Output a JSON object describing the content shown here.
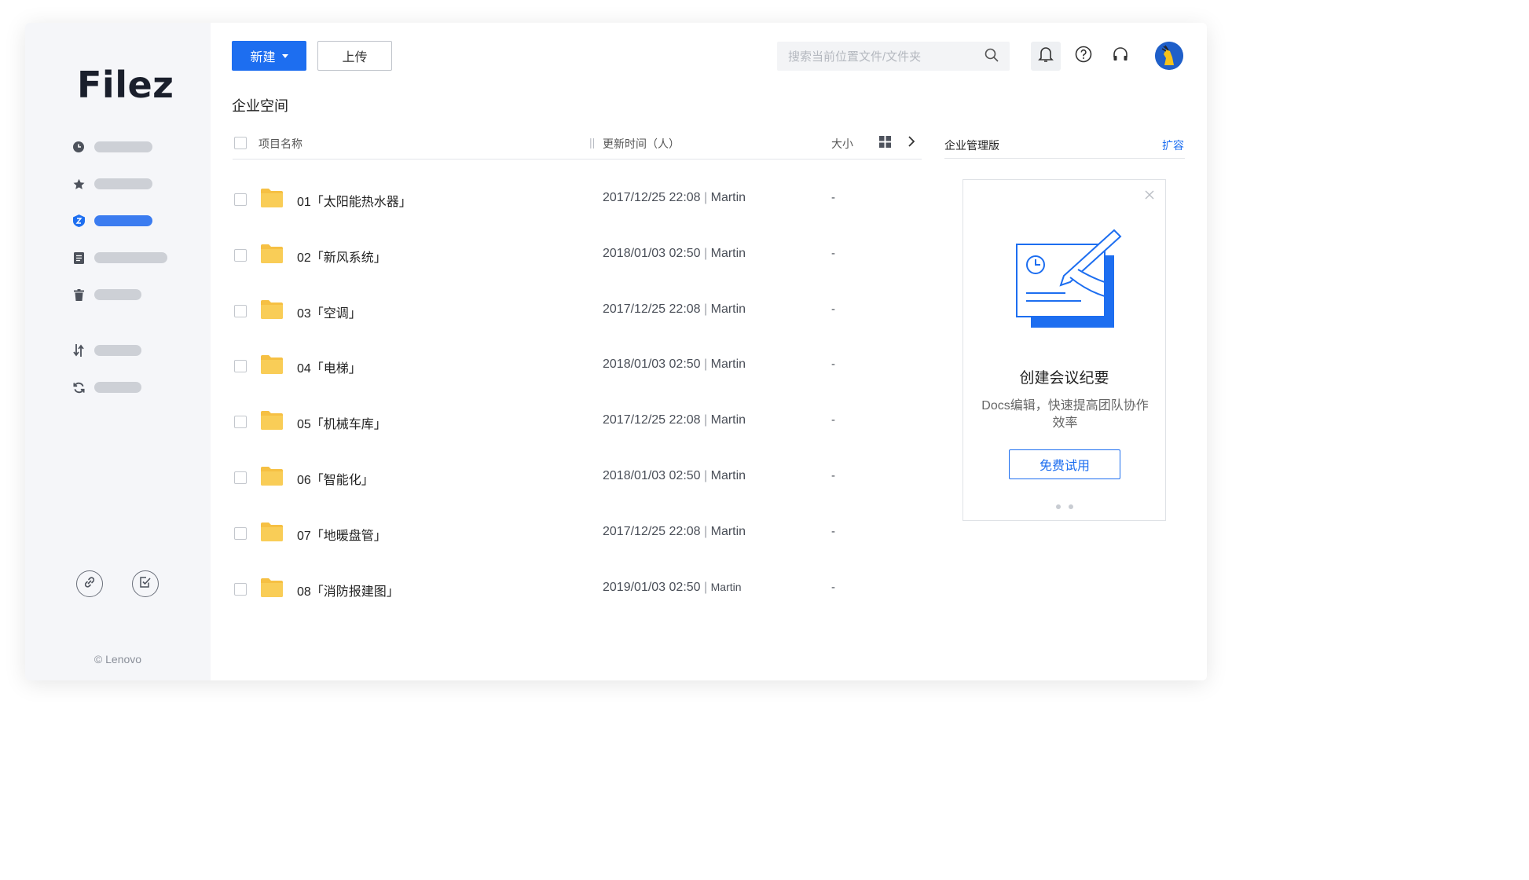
{
  "app": {
    "logo": "Filez",
    "copyright": "© Lenovo"
  },
  "colors": {
    "accent": "#1d6ef0",
    "folder": "#f6c043",
    "sidebar_active": "#3b7cf0"
  },
  "sidebar": {
    "items": [
      {
        "icon": "clock-icon",
        "active": false
      },
      {
        "icon": "star-icon",
        "active": false
      },
      {
        "icon": "enterprise-shield-icon",
        "active": true
      },
      {
        "icon": "document-icon",
        "active": false
      },
      {
        "icon": "trash-icon",
        "active": false
      },
      {
        "icon": "transfer-icon",
        "active": false
      },
      {
        "icon": "sync-icon",
        "active": false
      }
    ],
    "bottom": [
      {
        "icon": "link-icon"
      },
      {
        "icon": "sign-icon"
      }
    ]
  },
  "toolbar": {
    "new_label": "新建",
    "upload_label": "上传",
    "search_placeholder": "搜索当前位置文件/文件夹"
  },
  "header": {
    "icons": [
      "bell-icon",
      "help-icon",
      "headset-icon",
      "avatar"
    ]
  },
  "main": {
    "title": "企业空间",
    "columns": {
      "name": "项目名称",
      "time": "更新时间（人）",
      "size": "大小"
    },
    "rows": [
      {
        "name": "01「太阳能热水器」",
        "time": "2017/12/25 22:08",
        "user": "Martin",
        "size": "-"
      },
      {
        "name": "02「新风系统」",
        "time": "2018/01/03 02:50",
        "user": "Martin",
        "size": "-"
      },
      {
        "name": "03「空调」",
        "time": "2017/12/25 22:08",
        "user": "Martin",
        "size": "-"
      },
      {
        "name": "04「电梯」",
        "time": "2018/01/03 02:50",
        "user": "Martin",
        "size": "-"
      },
      {
        "name": "05「机械车库」",
        "time": "2017/12/25 22:08",
        "user": "Martin",
        "size": "-"
      },
      {
        "name": "06「智能化」",
        "time": "2018/01/03 02:50",
        "user": "Martin",
        "size": "-"
      },
      {
        "name": "07「地暖盘管」",
        "time": "2017/12/25 22:08",
        "user": "Martin",
        "size": "-"
      },
      {
        "name": "08「消防报建图」",
        "time": "2019/01/03 02:50",
        "user": "Martin",
        "size": "-"
      }
    ]
  },
  "panel": {
    "title": "企业管理版",
    "link": "扩容",
    "promo": {
      "title": "创建会议纪要",
      "desc": "Docs编辑，快速提高团队协作效率",
      "button": "免费试用"
    }
  }
}
